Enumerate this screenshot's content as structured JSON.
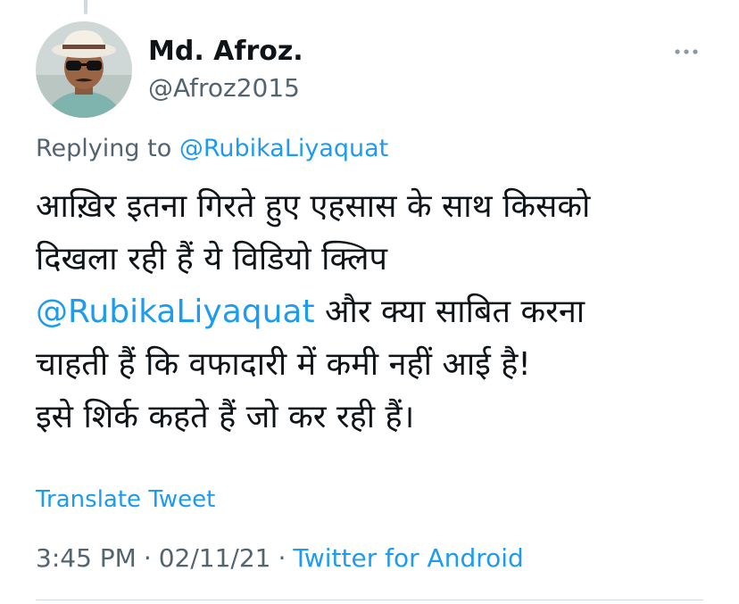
{
  "author": {
    "display_name": "Md. Afroz.",
    "handle": "@Afroz2015",
    "avatar": "avatar-photo"
  },
  "more_icon": "more-horizontal-icon",
  "reply_context": {
    "prefix": "Replying to ",
    "handle": "@RubikaLiyaquat"
  },
  "tweet": {
    "line1": "आख़िर इतना गिरते हुए एहसास के साथ किसको",
    "line2": "दिखला रही हैं ये विडियो क्लिप",
    "mention": "@RubikaLiyaquat",
    "line3_rest": " और क्या साबित करना",
    "line4": "चाहती हैं कि वफादारी में कमी नहीं आई है!",
    "line5": "इसे शिर्क कहते हैं जो कर रही हैं।"
  },
  "translate_label": "Translate Tweet",
  "meta": {
    "time": "3:45 PM",
    "separator": "·",
    "date": "02/11/21",
    "source": "Twitter for Android"
  },
  "colors": {
    "link": "#1d9bf0",
    "secondary_text": "#536471",
    "primary_text": "#0f1419",
    "divider": "#cfd9de"
  }
}
